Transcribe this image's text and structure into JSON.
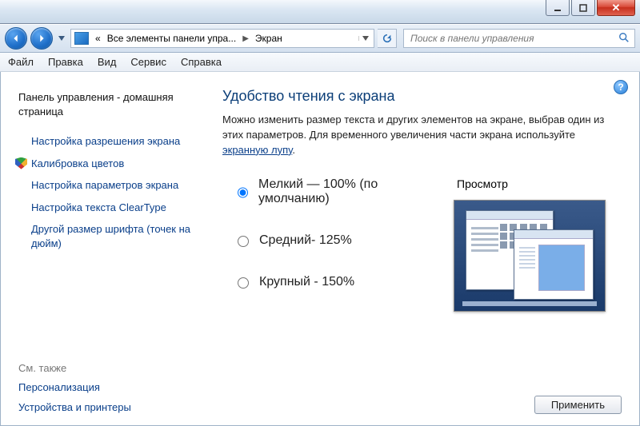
{
  "titlebar": {
    "minimize": "–",
    "maximize": "□",
    "close": "X"
  },
  "nav": {
    "crumb_prefix": "«",
    "crumb1": "Все элементы панели упра...",
    "crumb2": "Экран",
    "search_placeholder": "Поиск в панели управления"
  },
  "menu": {
    "file": "Файл",
    "edit": "Правка",
    "view": "Вид",
    "service": "Сервис",
    "help": "Справка"
  },
  "sidebar": {
    "home": "Панель управления - домашняя страница",
    "links": [
      "Настройка разрешения экрана",
      "Калибровка цветов",
      "Настройка параметров экрана",
      "Настройка текста ClearType",
      "Другой размер шрифта (точек на дюйм)"
    ],
    "see_also_heading": "См. также",
    "see_also": [
      "Персонализация",
      "Устройства и принтеры"
    ]
  },
  "content": {
    "heading": "Удобство чтения с экрана",
    "desc_pre": "Можно изменить размер текста и других элементов на экране, выбрав один из этих параметров. Для временного увеличения части экрана используйте ",
    "desc_link": "экранную лупу",
    "desc_post": ".",
    "options": [
      "Мелкий — 100% (по умолчанию)",
      "Средний- 125%",
      "Крупный - 150%"
    ],
    "preview_label": "Просмотр",
    "apply": "Применить"
  }
}
